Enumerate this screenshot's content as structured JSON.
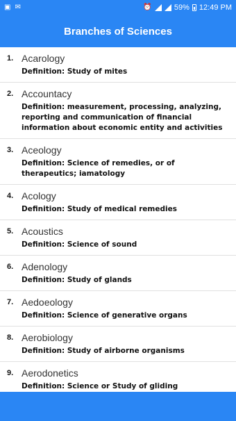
{
  "status_bar": {
    "battery": "59%",
    "time": "12:49 PM"
  },
  "app_bar": {
    "title": "Branches of Sciences"
  },
  "items": [
    {
      "num": "1.",
      "term": "Acarology",
      "definition": "Definition: Study of mites"
    },
    {
      "num": "2.",
      "term": "Accountacy",
      "definition": "Definition: measurement, processing, analyzing, reporting and communication of financial information about economic entity and activities"
    },
    {
      "num": "3.",
      "term": "Aceology",
      "definition": "Definition: Science of remedies, or of therapeutics; iamatology"
    },
    {
      "num": "4.",
      "term": "Acology",
      "definition": "Definition: Study of medical remedies"
    },
    {
      "num": "5.",
      "term": "Acoustics",
      "definition": "Definition: Science of sound"
    },
    {
      "num": "6.",
      "term": "Adenology",
      "definition": "Definition: Study of glands"
    },
    {
      "num": "7.",
      "term": "Aedoeology",
      "definition": "Definition: Science of generative organs"
    },
    {
      "num": "8.",
      "term": "Aerobiology",
      "definition": "Definition: Study of airborne organisms"
    },
    {
      "num": "9.",
      "term": "Aerodonetics",
      "definition": "Definition: Science or Study of gliding"
    }
  ]
}
